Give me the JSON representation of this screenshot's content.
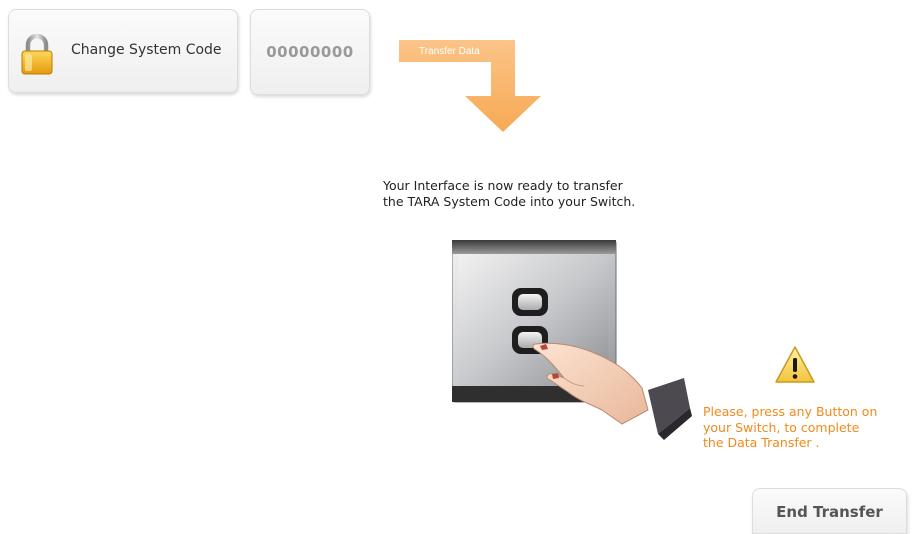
{
  "toolbar": {
    "change_code_label": "Change System Code",
    "system_code": "00000000"
  },
  "transfer_arrow": {
    "label": "Transfer Data",
    "color": "#f9b36a"
  },
  "status": {
    "ready_line_1": "Your Interface is now ready to transfer",
    "ready_line_2": "the TARA System Code into your Switch."
  },
  "instruction": {
    "line_1": "Please, press any Button on",
    "line_2": "your Switch, to complete",
    "line_3": "the Data Transfer .",
    "color": "#f08a1c"
  },
  "actions": {
    "end_transfer_label": "End Transfer"
  },
  "icons": {
    "lock": "lock-icon",
    "warning": "warning-icon",
    "switch": "wall-switch-with-hand"
  }
}
